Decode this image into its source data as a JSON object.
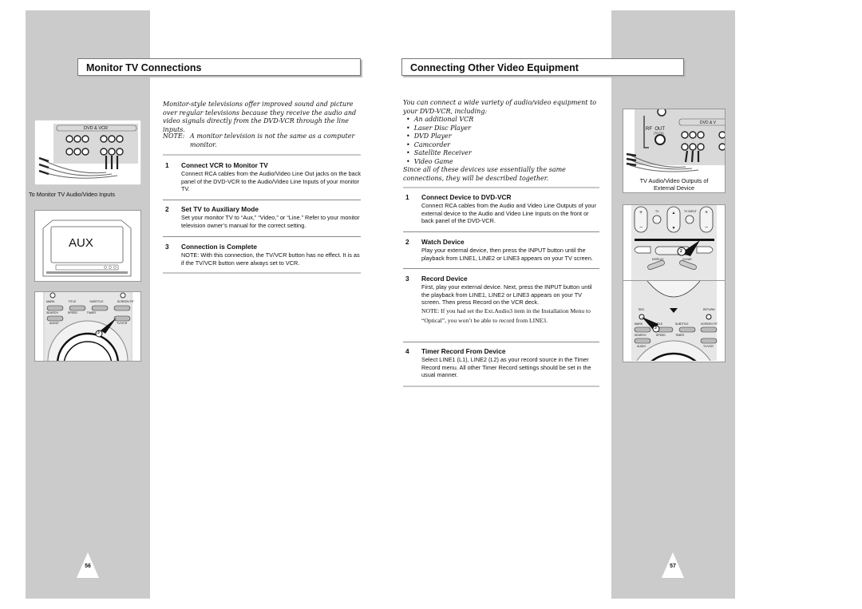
{
  "left_page": {
    "title": "Monitor TV Connections",
    "intro": "Monitor-style televisions offer improved sound and picture over regular televisions because they receive the audio and video signals directly from the DVD-VCR through the line inputs.",
    "note_label": "NOTE:",
    "note_text": "A monitor television is not the same as a computer monitor.",
    "steps": [
      {
        "num": "1",
        "title": "Connect VCR to Monitor TV",
        "body": "Connect RCA cables from the Audio/Video Line Out jacks on the back panel of the DVD-VCR to the Audio/Video Line Inputs of your monitor TV."
      },
      {
        "num": "2",
        "title": "Set TV to Auxiliary Mode",
        "body": "Set your monitor TV to “Aux,” “Video,” or “Line.” Refer to your monitor television owner’s manual for the correct setting."
      },
      {
        "num": "3",
        "title": "Connection is Complete",
        "body": "NOTE: With this connection, the TV/VCR button has no effect. It is as if the TV/VCR button were always set to VCR."
      }
    ],
    "figures": {
      "rear_panel_label": "DVD & VCR",
      "rear_panel_caption": "To Monitor TV Audio/Video Inputs",
      "tv_screen_text": "AUX",
      "remote_buttons": [
        "MARK",
        "TITLE",
        "SUBTITLE",
        "SCREEN FIT",
        "SEARCH",
        "SPEED",
        "TIMER",
        "AUDIO",
        "TV/VCR"
      ],
      "remote_callout": "3"
    },
    "page_number": "56"
  },
  "right_page": {
    "title": "Connecting Other Video Equipment",
    "intro": "You can connect a wide variety of audio/video equipment to your DVD-VCR, including:",
    "devices": [
      "An additional VCR",
      "Laser Disc Player",
      "DVD Player",
      "Camcorder",
      "Satellite Receiver",
      "Video Game"
    ],
    "intro_tail": "Since all of these devices use essentially the same connections, they will be described together.",
    "steps": [
      {
        "num": "1",
        "title": "Connect Device to DVD-VCR",
        "body": "Connect RCA cables from the Audio and Video Line Outputs of your external device to the Audio and Video Line Inputs on the front or back panel of the DVD-VCR."
      },
      {
        "num": "2",
        "title": "Watch Device",
        "body": "Play your external device, then press the INPUT button until the playback from LINE1, LINE2 or LINE3 appears on your TV screen."
      },
      {
        "num": "3",
        "title": "Record Device",
        "body": "First, play your external device. Next, press the INPUT button until the playback from LINE1, LINE2 or LINE3 appears on your TV screen. Then press Record on the VCR deck.",
        "note": "NOTE: If you had set the Ext.Audio3 item in the Installation Menu to “Optical”, you won’t be able to record from LINE3."
      },
      {
        "num": "4",
        "title": "Timer Record From Device",
        "body": "Select LINE1 (L1), LINE2 (L2) as your record source in the Timer Record menu. All other Timer Record settings should be set in the usual manner."
      }
    ],
    "figures": {
      "rear_panel_label": "DVD & V",
      "rf_label": "RF  OUT",
      "rf_sub": "(TO TV)",
      "rear_panel_caption_1": "TV Audio/Video Outputs of",
      "rear_panel_caption_2": "External Device",
      "remote_top_labels": [
        "TV",
        "TV INPUT"
      ],
      "remote_mid_labels": [
        "DISPLAY",
        "CLEAR"
      ],
      "remote_callout_2": "2",
      "remote_bottom_labels": [
        "REC",
        "RETURN",
        "MARK",
        "TITLE",
        "SUBTITLE",
        "SCREEN FIT",
        "SEARCH",
        "SPEED",
        "TIMER",
        "AUDIO",
        "TV/VCR"
      ],
      "remote_callout_3": "3"
    },
    "page_number": "57"
  }
}
